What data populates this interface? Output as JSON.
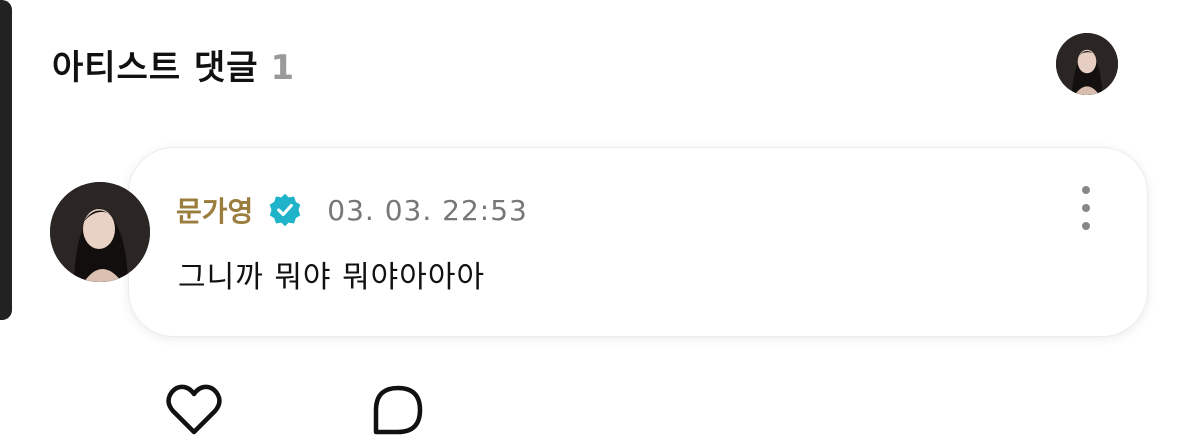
{
  "header": {
    "title": "아티스트 댓글",
    "count": "1"
  },
  "comment": {
    "author": "문가영",
    "timestamp": "03. 03. 22:53",
    "text": "그니까 뭐야 뭐야아아아"
  },
  "icons": {
    "verified": "verified-badge-icon",
    "more": "more-vertical-icon",
    "like": "heart-icon",
    "reply": "comment-bubble-icon"
  },
  "colors": {
    "author": "#9b7d3d",
    "verified": "#1fb3c9",
    "timestamp": "#777777"
  }
}
